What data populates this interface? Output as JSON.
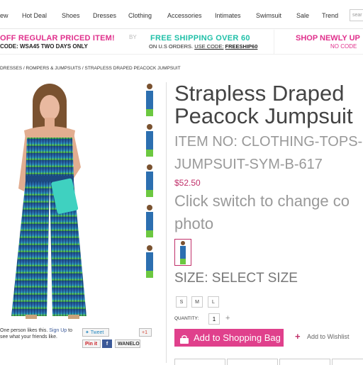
{
  "nav": {
    "items": [
      "ew",
      "Hot Deal",
      "Shoes",
      "Dresses",
      "Clothing",
      "Accessories",
      "Intimates",
      "Swimsuit",
      "Sale",
      "Trend"
    ],
    "search_placeholder": "sear"
  },
  "promos": {
    "a_line1": "OFF REGULAR PRICED ITEM!",
    "a_line2": "CODE: WSA45 TWO DAYS ONLY",
    "b_sep": "BY",
    "b_line1": "FREE SHIPPING OVER 60",
    "b_line2_prefix": "ON U.S ORDERS.",
    "b_line2_use": "USE CODE:",
    "b_line2_code": "FREESHIP60",
    "c_line1": "SHOP NEWLY UP",
    "c_line2": "NO CODE"
  },
  "breadcrumb": "DRESSES / ROMPERS & JUMPSUITS / STRAPLESS DRAPED PEACOCK JUMPSUIT",
  "product": {
    "title_line1": "Strapless Draped",
    "title_line2": "Peacock Jumpsuit",
    "itemno_line1": "ITEM NO: CLOTHING-TOPS-",
    "itemno_line2": "JUMPSUIT-SYM-B-617",
    "price": "$52.50",
    "switch_line1": "Click switch to change co",
    "switch_line2": "photo",
    "size_label": "SIZE: SELECT SIZE",
    "sizes": [
      "S",
      "M",
      "L"
    ],
    "quantity_label": "QUANTITY:",
    "quantity": "1",
    "quantity_plus": "+",
    "add_to_bag": "Add to Shopping Bag",
    "wishlist_plus": "+",
    "wishlist": "Add to Wishlist"
  },
  "social": {
    "like_text_1": "One person likes this.",
    "like_link": "Sign Up",
    "like_text_2": "to",
    "like_text_3": "see what your friends like.",
    "tweet": "Tweet",
    "gplus": "+1",
    "pinit": "Pin it",
    "fb": "f",
    "wanelo": "WANELO"
  },
  "colors": {
    "brand_pink": "#e0308c",
    "teal": "#20c0a8",
    "price": "#c0306a"
  }
}
